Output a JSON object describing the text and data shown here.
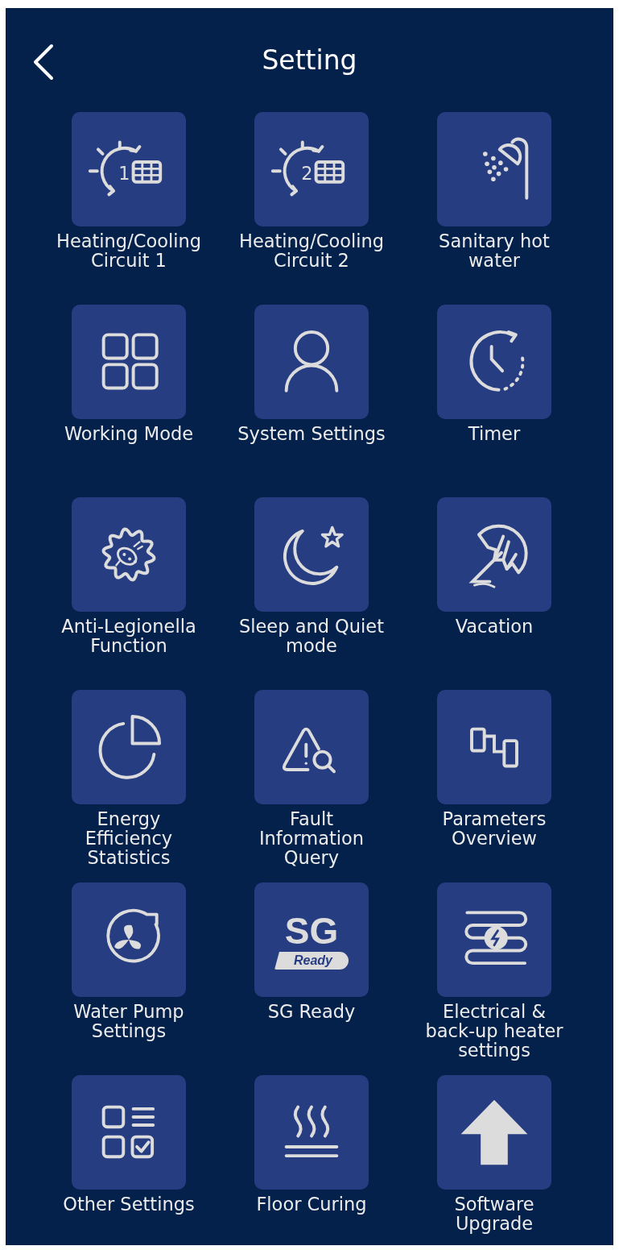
{
  "header": {
    "title": "Setting"
  },
  "rows": [
    {
      "items": [
        {
          "label": "Heating/Cooling\nCircuit 1",
          "icon_text": "1"
        },
        {
          "label": "Heating/Cooling\nCircuit 2",
          "icon_text": "2"
        },
        {
          "label": "Sanitary hot\nwater"
        }
      ]
    },
    {
      "items": [
        {
          "label": "Working Mode"
        },
        {
          "label": "System Settings"
        },
        {
          "label": "Timer"
        }
      ]
    },
    {
      "items": [
        {
          "label": "Anti-Legionella\nFunction"
        },
        {
          "label": "Sleep and Quiet\nmode"
        },
        {
          "label": "Vacation"
        }
      ]
    },
    {
      "items": [
        {
          "label": "Energy\nEfficiency\nStatistics"
        },
        {
          "label": "Fault\nInformation\nQuery"
        },
        {
          "label": "Parameters\nOverview"
        }
      ]
    },
    {
      "items": [
        {
          "label": "Water Pump\nSettings"
        },
        {
          "label": "SG Ready",
          "icon_text": "SG",
          "icon_tag": "Ready"
        },
        {
          "label": "Electrical &\nback-up heater\nsettings"
        }
      ]
    },
    {
      "items": [
        {
          "label": "Other Settings"
        },
        {
          "label": "Floor Curing"
        },
        {
          "label": "Software\nUpgrade"
        }
      ]
    }
  ]
}
